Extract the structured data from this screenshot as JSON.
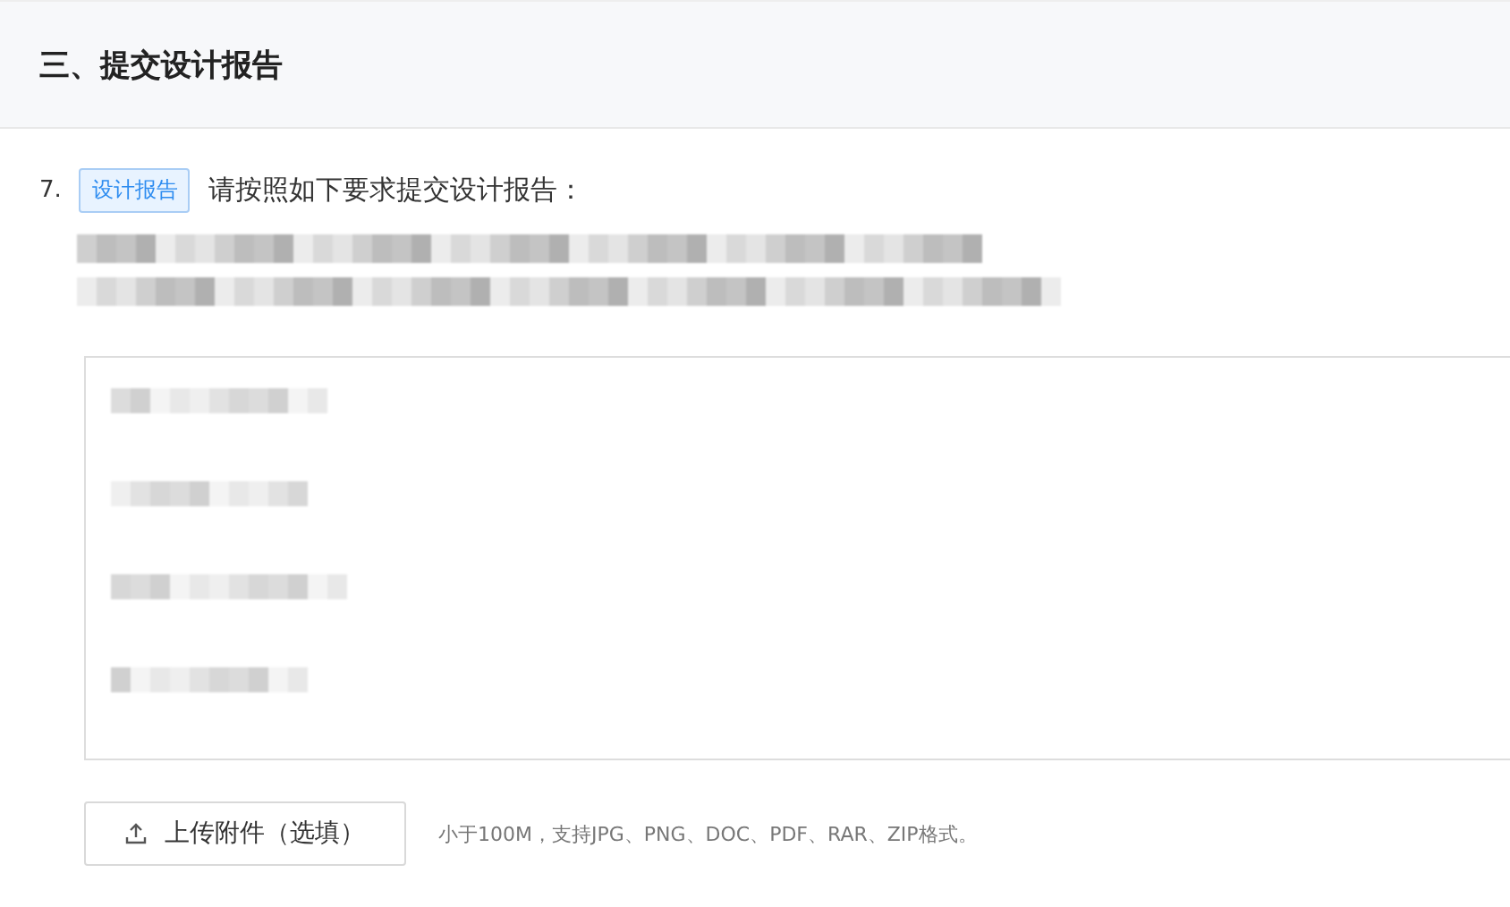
{
  "section": {
    "title": "三、提交设计报告"
  },
  "question": {
    "number": "7.",
    "tag": "设计报告",
    "prompt": "请按照如下要求提交设计报告："
  },
  "upload": {
    "button": "上传附件（选填）",
    "hint": "小于100M，支持JPG、PNG、DOC、PDF、RAR、ZIP格式。"
  }
}
